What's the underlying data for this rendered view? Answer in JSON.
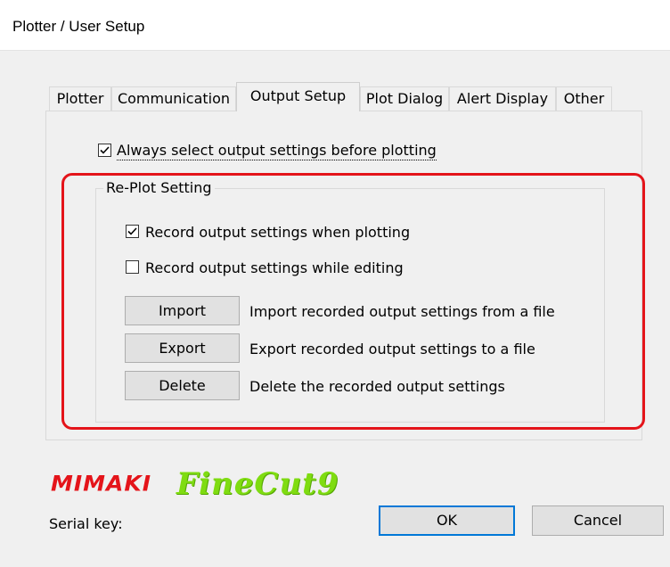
{
  "window": {
    "title": "Plotter / User Setup"
  },
  "tabs": [
    {
      "label": "Plotter"
    },
    {
      "label": "Communication"
    },
    {
      "label": "Output Setup"
    },
    {
      "label": "Plot Dialog"
    },
    {
      "label": "Alert Display"
    },
    {
      "label": "Other"
    }
  ],
  "active_tab": "Output Setup",
  "always_select": {
    "label": "Always select output settings before plotting",
    "checked": true
  },
  "replot": {
    "title": "Re-Plot Setting",
    "record_when_plotting": {
      "label": "Record output settings when plotting",
      "checked": true
    },
    "record_while_editing": {
      "label": "Record output settings while editing",
      "checked": false
    },
    "import": {
      "button": "Import",
      "description": "Import recorded output settings from a file"
    },
    "export": {
      "button": "Export",
      "description": "Export recorded output settings to a file"
    },
    "delete": {
      "button": "Delete",
      "description": "Delete the recorded output settings"
    }
  },
  "branding": {
    "mimaki": "MIMAKI",
    "product": "FineCut9"
  },
  "serial": {
    "label": "Serial key:"
  },
  "buttons": {
    "ok": "OK",
    "cancel": "Cancel"
  },
  "colors": {
    "highlight_box": "#e4141a",
    "brand_red": "#e4141a",
    "brand_green": "#7fdc11",
    "default_button_border": "#0078d7"
  }
}
